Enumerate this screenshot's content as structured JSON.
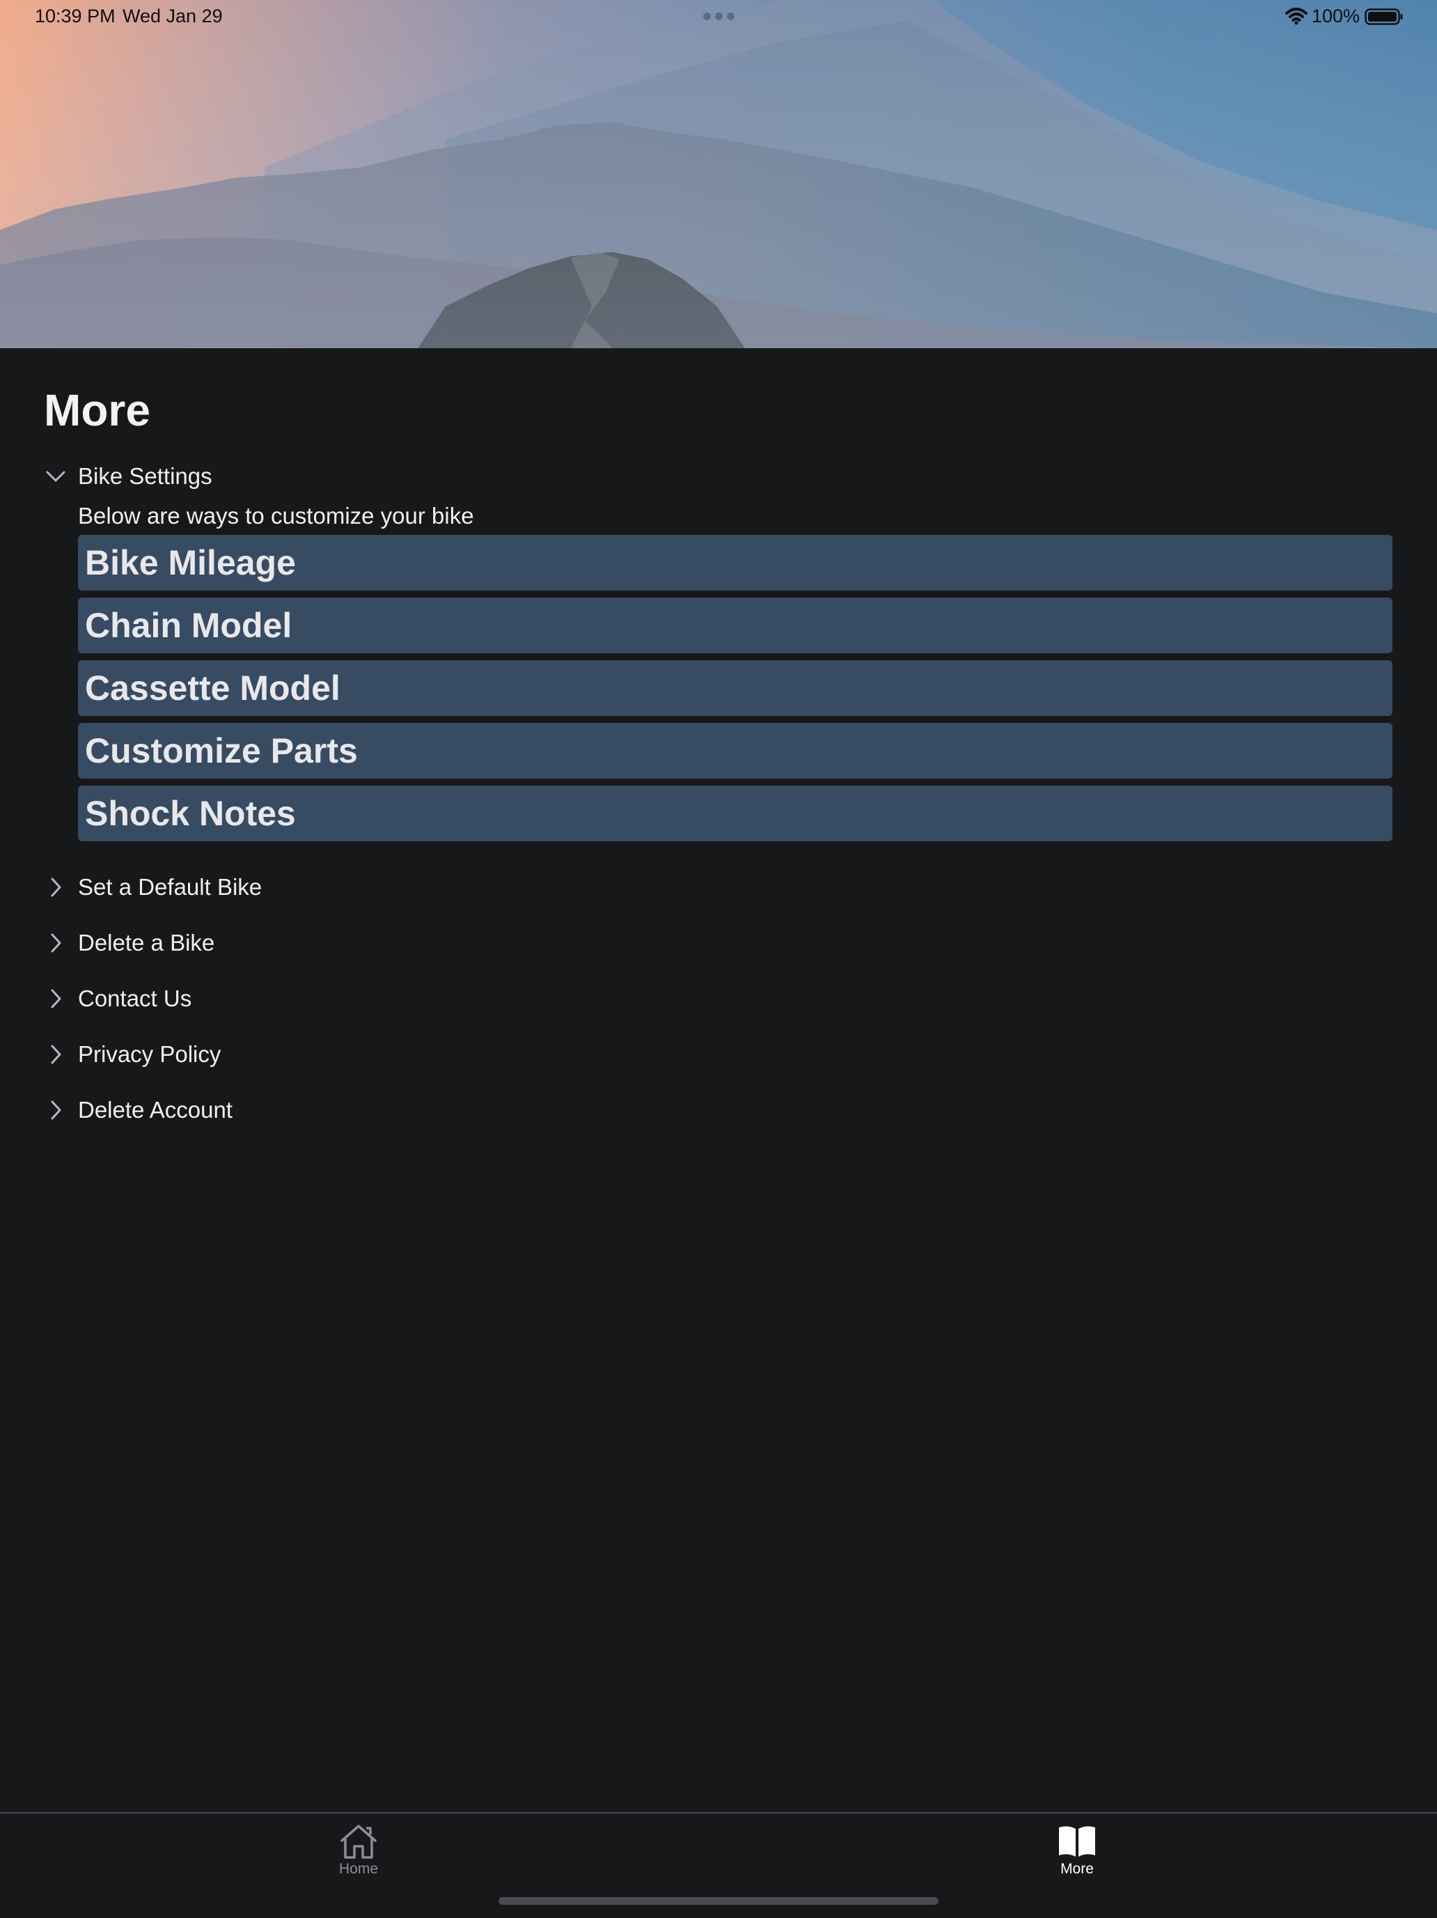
{
  "status_bar": {
    "time": "10:39 PM",
    "date": "Wed Jan 29",
    "battery_percent": "100%",
    "battery_level": 1.0,
    "icons": [
      "wifi-icon",
      "battery-icon"
    ]
  },
  "page": {
    "title": "More"
  },
  "sections": {
    "bike_settings": {
      "label": "Bike Settings",
      "expanded": true,
      "description": "Below are ways to customize your bike",
      "buttons": [
        "Bike Mileage",
        "Chain Model",
        "Cassette Model",
        "Customize Parts",
        "Shock Notes"
      ]
    },
    "collapsed": [
      "Set a Default Bike",
      "Delete a Bike",
      "Contact Us",
      "Privacy Policy",
      "Delete Account"
    ]
  },
  "tabbar": {
    "tabs": [
      {
        "label": "Home",
        "icon": "house-icon",
        "selected": false
      },
      {
        "label": "More",
        "icon": "book-icon",
        "selected": true
      }
    ]
  },
  "colors": {
    "background": "#17181a",
    "button_bg": "#374b63",
    "text": "#ececee",
    "tab_inactive": "#8d8e92"
  }
}
